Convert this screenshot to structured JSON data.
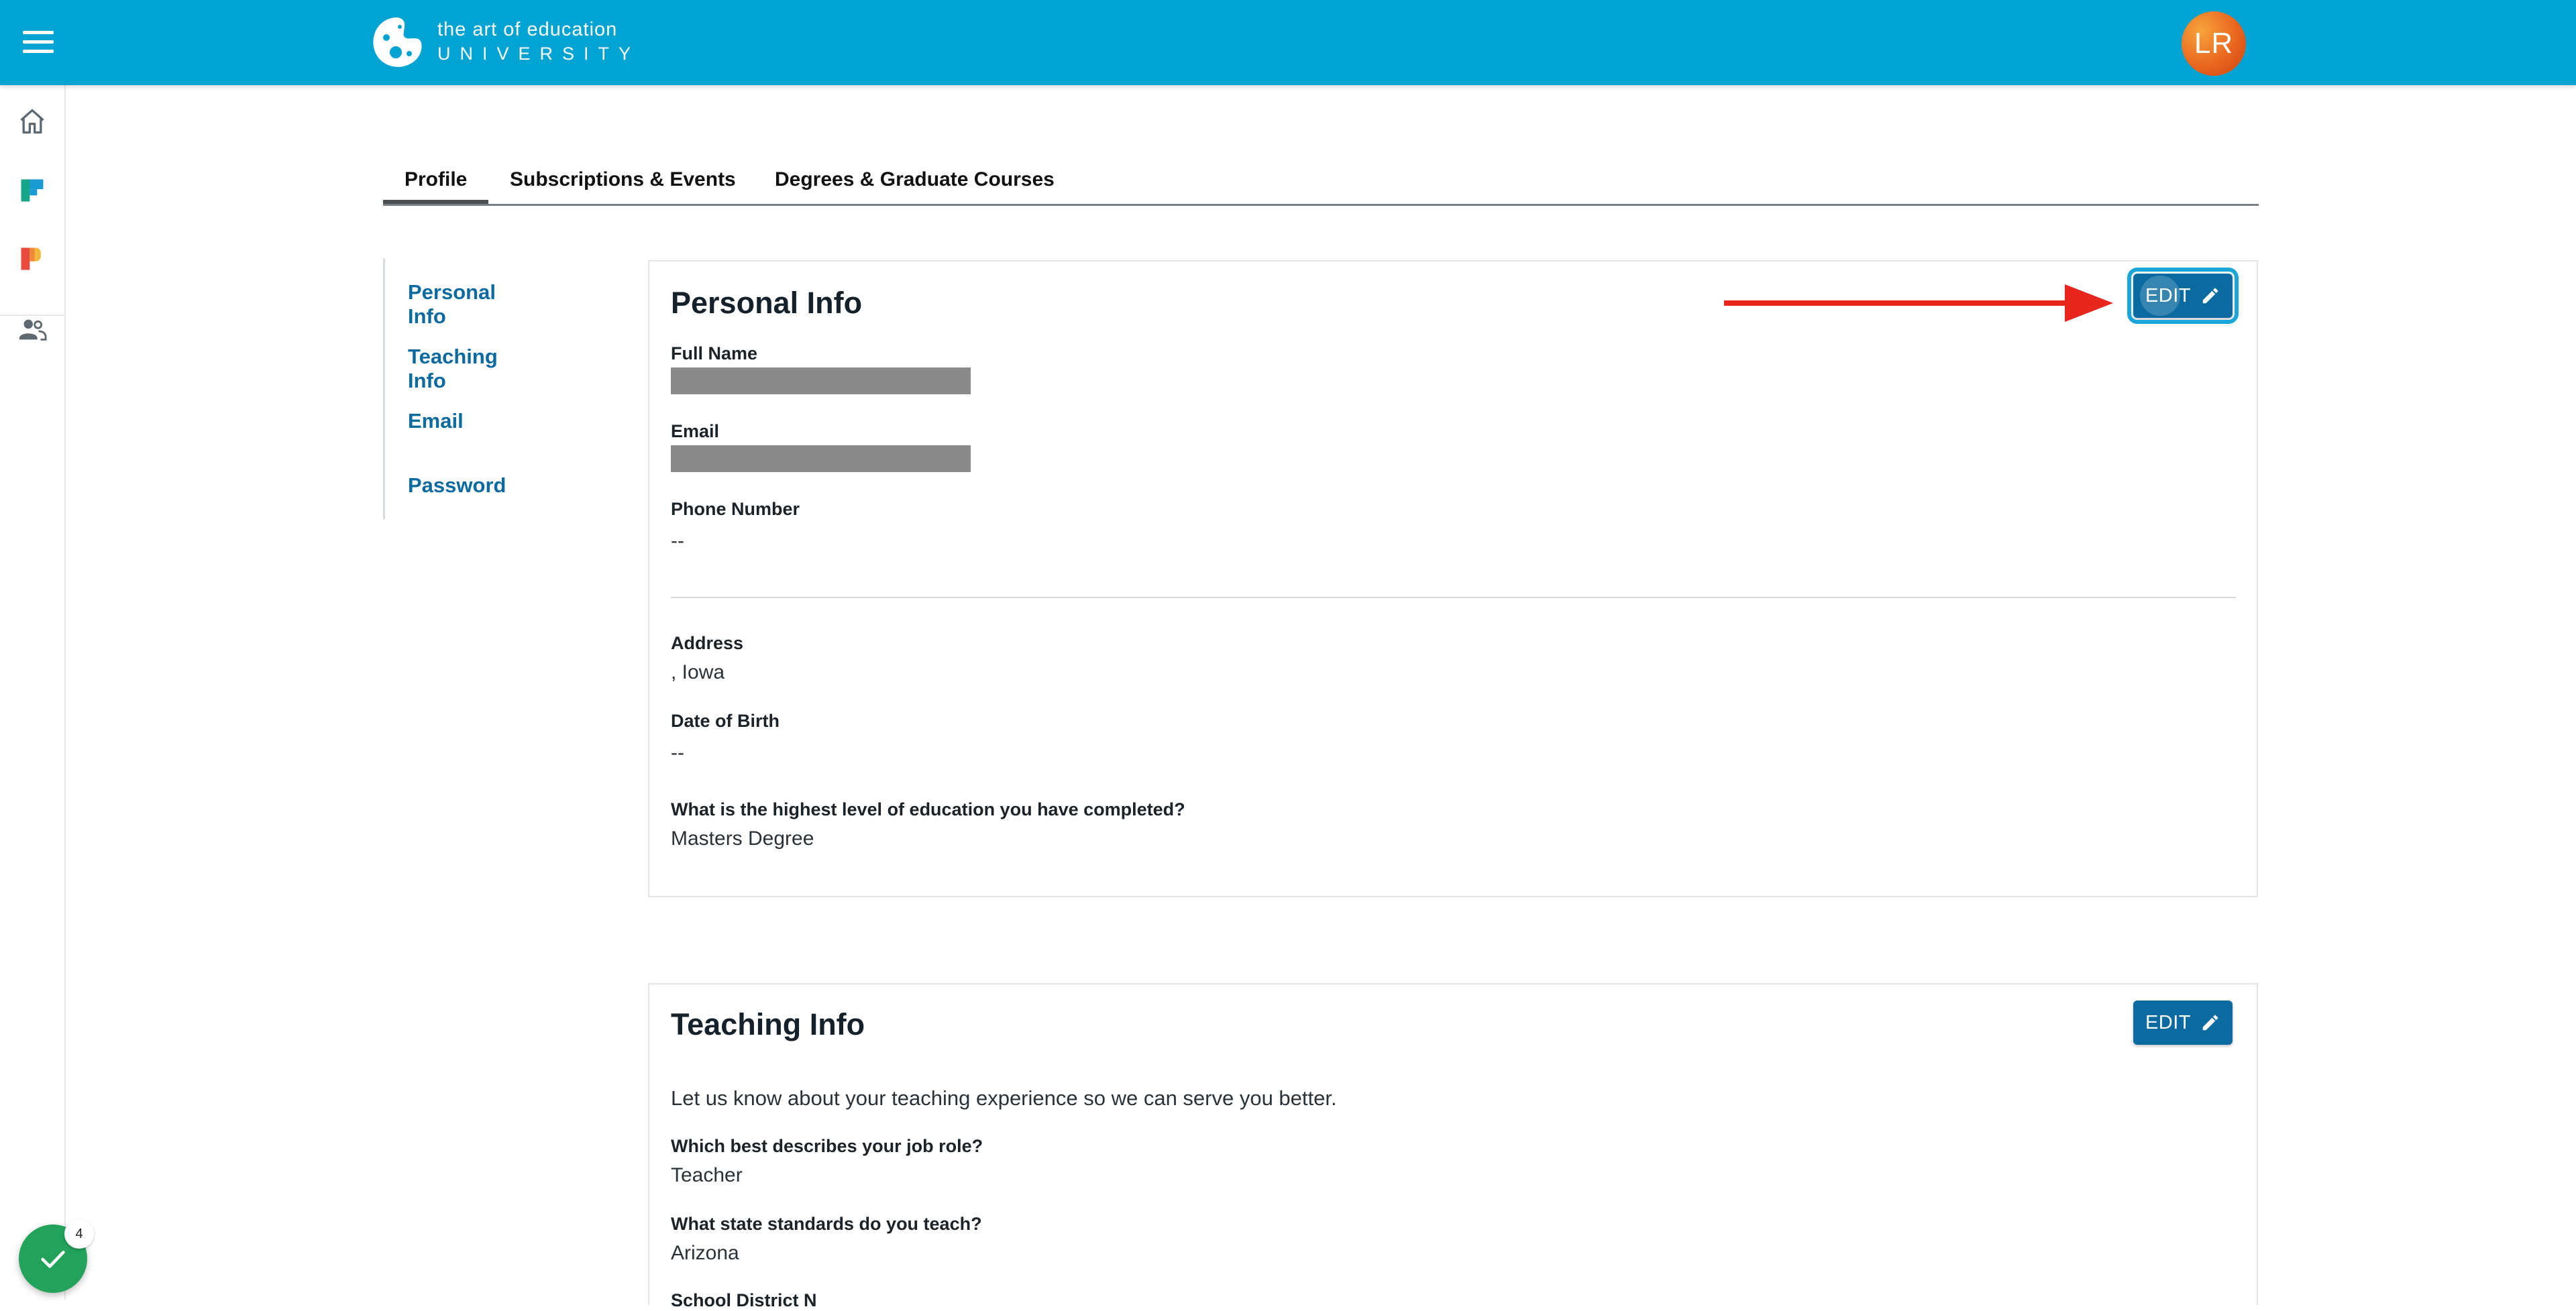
{
  "header": {
    "logo_line1": "the art of education",
    "logo_line2": "UNIVERSITY",
    "avatar_initials": "LR"
  },
  "tabs": [
    {
      "label": "Profile",
      "active": true
    },
    {
      "label": "Subscriptions & Events",
      "active": false
    },
    {
      "label": "Degrees & Graduate Courses",
      "active": false
    }
  ],
  "sidenav": [
    "Personal Info",
    "Teaching Info",
    "Email",
    "Password"
  ],
  "personal_info": {
    "title": "Personal Info",
    "edit_label": "EDIT",
    "fields": {
      "full_name_label": "Full Name",
      "email_label": "Email",
      "phone_label": "Phone Number",
      "phone_value": "--",
      "address_label": "Address",
      "address_value": ", Iowa",
      "dob_label": "Date of Birth",
      "dob_value": "--",
      "education_label": "What is the highest level of education you have completed?",
      "education_value": "Masters Degree"
    }
  },
  "teaching_info": {
    "title": "Teaching Info",
    "edit_label": "EDIT",
    "intro": "Let us know about your teaching experience so we can serve you better.",
    "job_role_label": "Which best describes your job role?",
    "job_role_value": "Teacher",
    "standards_label": "What state standards do you teach?",
    "standards_value": "Arizona",
    "district_label": "School District N"
  },
  "status_widget": {
    "count": "4"
  },
  "colors": {
    "header": "#00a3d1",
    "link": "#0b6ba0",
    "button": "#0b6ba0",
    "arrow": "#e8261e"
  }
}
